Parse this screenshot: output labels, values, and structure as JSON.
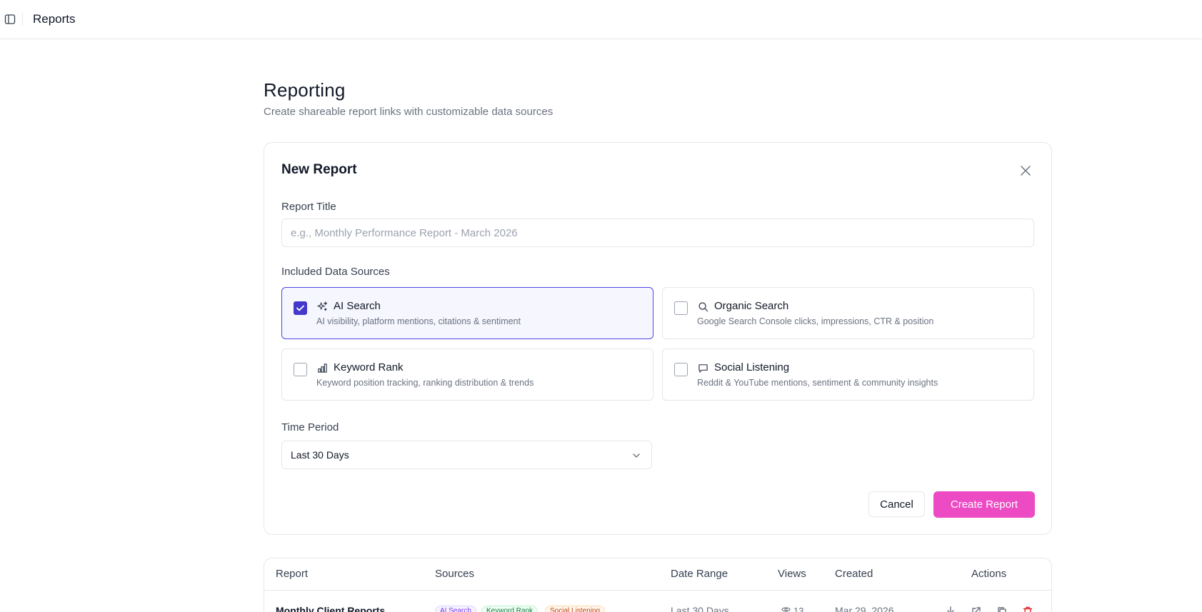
{
  "topbar": {
    "title": "Reports"
  },
  "header": {
    "title": "Reporting",
    "subtitle": "Create shareable report links with customizable data sources"
  },
  "form": {
    "title": "New Report",
    "report_title_label": "Report Title",
    "report_title_placeholder": "e.g., Monthly Performance Report - March 2026",
    "report_title_value": "",
    "sources_label": "Included Data Sources",
    "sources": [
      {
        "name": "AI Search",
        "description": "AI visibility, platform mentions, citations & sentiment",
        "checked": true,
        "icon": "sparkles-icon"
      },
      {
        "name": "Organic Search",
        "description": "Google Search Console clicks, impressions, CTR & position",
        "checked": false,
        "icon": "search-icon"
      },
      {
        "name": "Keyword Rank",
        "description": "Keyword position tracking, ranking distribution & trends",
        "checked": false,
        "icon": "bar-chart-icon"
      },
      {
        "name": "Social Listening",
        "description": "Reddit & YouTube mentions, sentiment & community insights",
        "checked": false,
        "icon": "message-icon"
      }
    ],
    "time_period_label": "Time Period",
    "time_period_value": "Last 30 Days",
    "cancel_label": "Cancel",
    "create_label": "Create Report"
  },
  "table": {
    "headers": [
      "Report",
      "Sources",
      "Date Range",
      "Views",
      "Created",
      "Actions"
    ],
    "rows": [
      {
        "report": "Monthly Client Reports",
        "sources": [
          "AI Search",
          "Keyword Rank",
          "Social Listening"
        ],
        "date_range": "Last 30 Days",
        "views": "13",
        "created": "Mar 29, 2026"
      }
    ]
  },
  "colors": {
    "accent": "#ec4bc4",
    "checkbox": "#4338ca",
    "delete": "#dc2626"
  }
}
